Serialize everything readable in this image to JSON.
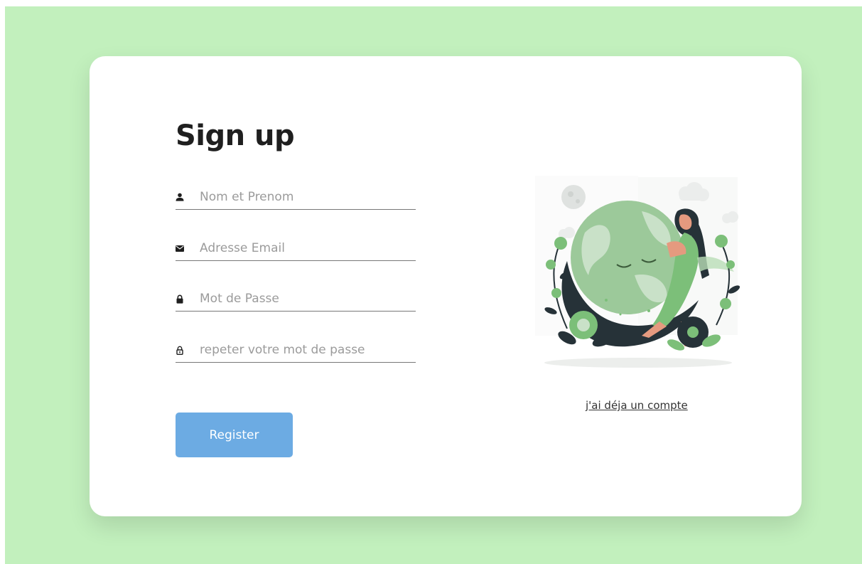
{
  "page": {
    "background_color": "#c2f0bd",
    "card_color": "#ffffff"
  },
  "form": {
    "title": "Sign up",
    "fields": [
      {
        "icon": "user-icon",
        "placeholder": "Nom et Prenom",
        "value": ""
      },
      {
        "icon": "envelope-icon",
        "placeholder": "Adresse Email",
        "value": ""
      },
      {
        "icon": "lock-icon",
        "placeholder": "Mot de Passe",
        "value": ""
      },
      {
        "icon": "lock-outline-icon",
        "placeholder": "repeter votre mot de passe",
        "value": ""
      }
    ],
    "register_label": "Register",
    "register_color": "#6cabe3"
  },
  "aside": {
    "illustration": "earth-hug-illustration",
    "login_link": "j'ai déja un compte"
  }
}
